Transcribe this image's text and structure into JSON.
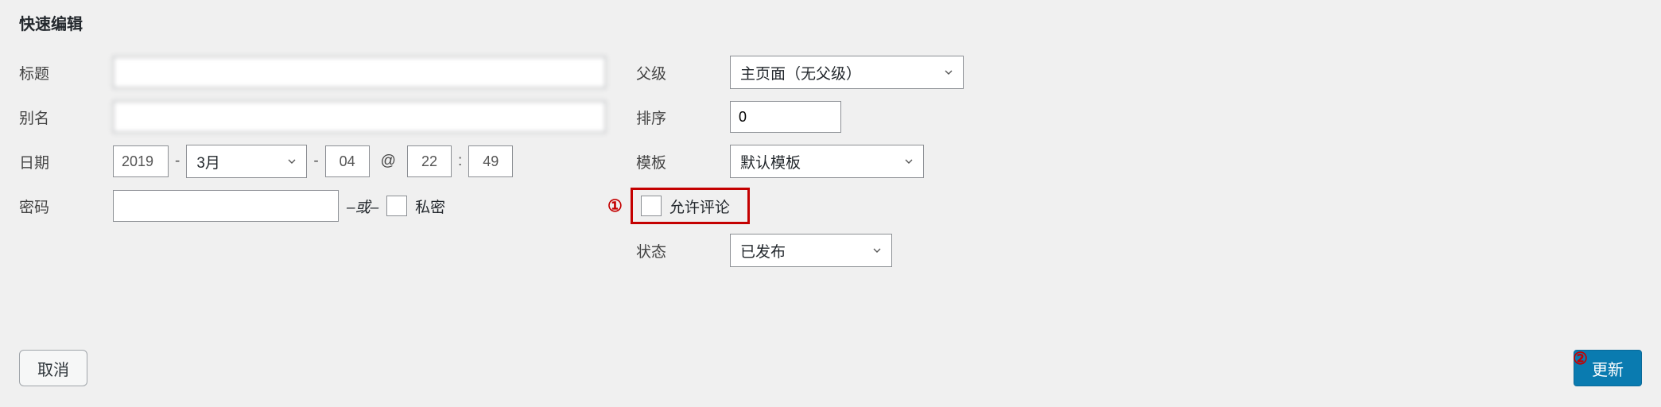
{
  "heading": "快速编辑",
  "left": {
    "title_label": "标题",
    "title_value": "",
    "slug_label": "别名",
    "slug_value": "",
    "date_label": "日期",
    "year": "2019",
    "month": "3月",
    "day": "04",
    "hour": "22",
    "minute": "49",
    "at_symbol": "@",
    "dash": "-",
    "colon": ":",
    "password_label": "密码",
    "password_value": "",
    "or_text": "–或–",
    "private_label": "私密"
  },
  "right": {
    "parent_label": "父级",
    "parent_value": "主页面（无父级）",
    "order_label": "排序",
    "order_value": "0",
    "template_label": "模板",
    "template_value": "默认模板",
    "comments_label": "允许评论",
    "status_label": "状态",
    "status_value": "已发布"
  },
  "annotations": {
    "one": "①",
    "two": "②"
  },
  "buttons": {
    "cancel": "取消",
    "update": "更新"
  }
}
